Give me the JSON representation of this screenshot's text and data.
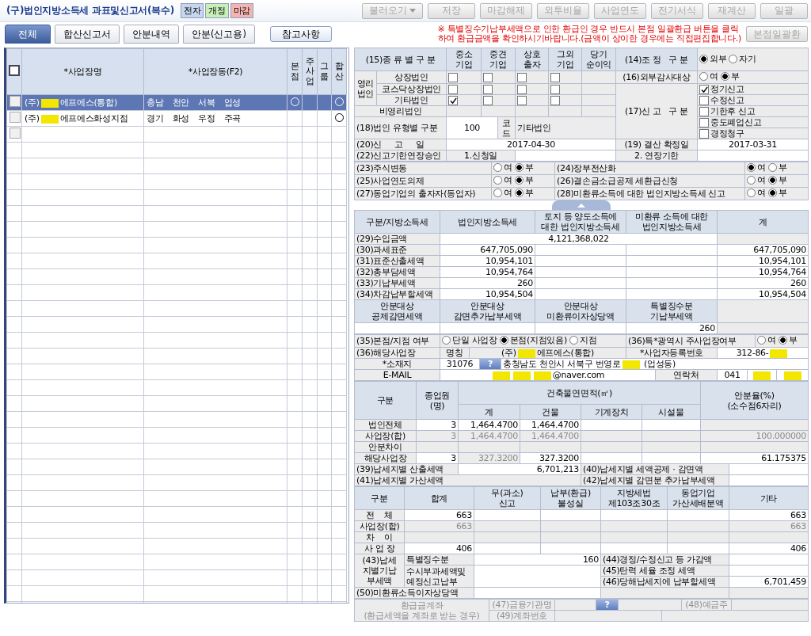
{
  "title": "(구)법인지방소득세 과표및신고서(복수)",
  "badges": [
    {
      "label": "전자",
      "color": "#c6d6ee"
    },
    {
      "label": "개정",
      "color": "#c8efb8"
    },
    {
      "label": "마감",
      "color": "#f5b4b4"
    }
  ],
  "toolbar": [
    {
      "label": "불러오기",
      "kind": "dropdown",
      "disabled": true
    },
    {
      "label": "저장",
      "kind": "button",
      "disabled": true
    },
    {
      "label": "마감해제",
      "kind": "button",
      "disabled": true
    },
    {
      "label": "외투비율",
      "kind": "button",
      "disabled": true
    },
    {
      "label": "사업연도",
      "kind": "button",
      "disabled": true
    },
    {
      "label": "전기서식",
      "kind": "button",
      "disabled": true
    },
    {
      "label": "재계산",
      "kind": "button",
      "disabled": true
    },
    {
      "label": "일괄",
      "kind": "button",
      "disabled": true
    }
  ],
  "tabs": [
    {
      "label": "전체",
      "selected": true
    },
    {
      "label": "합산신고서",
      "selected": false
    },
    {
      "label": "안분내역",
      "selected": false
    },
    {
      "label": "안분(신고용)",
      "selected": false
    }
  ],
  "reference_button": "참고사항",
  "notice": [
    "※ 특별징수기납부세액으로 인한 환급인 경우 반드시 본점 일괄환급 버튼을 클릭",
    "하여 환급금액을 확인하시기바랍니다.(금액이 상이한 경우에는 직접편집합니다.)"
  ],
  "hq_refund_button": {
    "label": "본점일괄환",
    "disabled": true
  },
  "sites": {
    "all_checked": false,
    "empty_row_checked": false,
    "columns": [
      "*사업장명",
      "*사업장동(F2)",
      "본점",
      "주사업",
      "그룹",
      "합산"
    ],
    "rows": [
      {
        "checked": false,
        "selected": true,
        "prefix": "(주)",
        "name": "에프에스(통합)",
        "dong": "충남 천안 서북 업성",
        "hq": true,
        "main": false,
        "group": false,
        "merged": true
      },
      {
        "checked": false,
        "selected": false,
        "prefix": "(주)",
        "name": "에프에스화성지점",
        "dong": "경기 화성 우정 주곡",
        "hq": false,
        "main": false,
        "group": false,
        "merged": true
      }
    ]
  },
  "kind_table": {
    "title": "(15)종 류 별 구 분",
    "columns": [
      "중소\n기업",
      "중견\n기업",
      "상호\n출자",
      "그외\n기업",
      "당기\n순이익"
    ],
    "group": "영리\n법인",
    "rows": [
      {
        "label": "상장법인",
        "checks": [
          false,
          false,
          false,
          false
        ]
      },
      {
        "label": "코스닥상장법인",
        "checks": [
          false,
          false,
          false,
          false
        ]
      },
      {
        "label": "기타법인",
        "checks": [
          true,
          false,
          false,
          false
        ]
      }
    ],
    "nonprofit": "비영리법인"
  },
  "adjustment": {
    "label": "(14)조 정   구 분",
    "options": [
      {
        "label": "외부",
        "selected": true
      },
      {
        "label": "자기",
        "selected": false
      }
    ]
  },
  "external_audit": {
    "label": "(16)외부감사대상",
    "options": [
      {
        "label": "여",
        "selected": false
      },
      {
        "label": "부",
        "selected": true
      }
    ]
  },
  "report_type": {
    "label": "(17)신 고   구 분",
    "options": [
      {
        "label": "정기신고",
        "checked": true
      },
      {
        "label": "수정신고",
        "checked": false
      },
      {
        "label": "기한후 신고",
        "checked": false
      },
      {
        "label": "중도폐업신고",
        "checked": false
      },
      {
        "label": "경정청구",
        "checked": false
      }
    ]
  },
  "corp_type": {
    "label": "(18)법인 유형별 구분",
    "code": "100",
    "code_label": "코\n드",
    "name": "기타법인"
  },
  "filing_date": {
    "label": "(20)신     고     일",
    "value": "2017-04-30"
  },
  "closing_date": {
    "label": "(19) 결산 확정일",
    "value": "2017-03-31"
  },
  "extension": {
    "label": "(22)신고기한연장승인",
    "apply_label": "1.신청일",
    "deadline_label": "2. 연장기한"
  },
  "yes_no": [
    {
      "label": "(23)주식변동",
      "options": [
        {
          "label": "여",
          "selected": false
        },
        {
          "label": "부",
          "selected": true
        }
      ]
    },
    {
      "label": "(24)장부전산화",
      "options": [
        {
          "label": "여",
          "selected": true
        },
        {
          "label": "부",
          "selected": false
        }
      ]
    },
    {
      "label": "(25)사업연도의제",
      "options": [
        {
          "label": "여",
          "selected": false
        },
        {
          "label": "부",
          "selected": true
        }
      ]
    },
    {
      "label": "(26)결손금소급공제 세환급신청",
      "options": [
        {
          "label": "여",
          "selected": false
        },
        {
          "label": "부",
          "selected": true
        }
      ]
    },
    {
      "label": "(27)동업기업의 출자자(동업자)",
      "options": [
        {
          "label": "여",
          "selected": false
        },
        {
          "label": "부",
          "selected": true
        }
      ]
    },
    {
      "label": "(28)미환류소득에 대한 법인지방소득세 신고",
      "options": [
        {
          "label": "여",
          "selected": false
        },
        {
          "label": "부",
          "selected": true
        }
      ]
    }
  ],
  "tax": {
    "columns": [
      "구분/지방소득세",
      "법인지방소득세",
      "토지 등 양도소득에\n대한 법인지방소득세",
      "미환류 소득에 대한\n법인지방소득세",
      "계"
    ],
    "revenue": {
      "label": "(29)수입금액",
      "value": "4,121,368,022"
    },
    "rows": [
      {
        "label": "(30)과세표준",
        "corp": "647,705,090",
        "total": "647,705,090"
      },
      {
        "label": "(31)표준산출세액",
        "corp": "10,954,101",
        "total": "10,954,101"
      },
      {
        "label": "(32)총부담세액",
        "corp": "10,954,764",
        "total": "10,954,764"
      },
      {
        "label": "(33)기납부세액",
        "corp": "260",
        "total": "260"
      },
      {
        "label": "(34)차감납부할세액",
        "corp": "10,954,504",
        "total": "10,954,504"
      }
    ],
    "alloc_columns": [
      "안분대상\n공제감면세액",
      "안분대상\n감면추가납부세액",
      "안분대상\n미환류이자상당액",
      "특별징수분\n기납부세액"
    ],
    "withheld": "260"
  },
  "branch": {
    "label": "(35)본점/지점 여부",
    "options": [
      {
        "label": "단일 사업장",
        "selected": false
      },
      {
        "label": "본점(지점있음)",
        "selected": true
      },
      {
        "label": "지점",
        "selected": false
      }
    ]
  },
  "metro": {
    "label": "(36)특*광역시 주사업장여부",
    "options": [
      {
        "label": "여",
        "selected": false
      },
      {
        "label": "부",
        "selected": true
      }
    ]
  },
  "site": {
    "label": "(36)해당사업장",
    "name_label": "명칭",
    "prefix": "(주)",
    "name": "에프에스(통합)",
    "regno_label": "*사업자등록번호",
    "regno": "312-86-"
  },
  "address": {
    "label": "*소재지",
    "zip": "31076",
    "search_button": "?",
    "street": "충청남도 천안시 서북구 번영로",
    "dong": "(업성동)"
  },
  "email": {
    "label": "E-MAIL",
    "domain": "@naver.com",
    "phone_label": "연락처",
    "area_code": "041"
  },
  "area": {
    "header_top": [
      "구분",
      "종업원\n(명)",
      "건축물연면적(㎡)",
      "안분율(%)\n(소수점6자리)"
    ],
    "header_sub": [
      "계",
      "건물",
      "기계장치",
      "시설물"
    ],
    "rows": [
      {
        "cells": [
          {
            "kind": "label",
            "text": "법인전체"
          },
          {
            "kind": "input",
            "text": "3"
          },
          {
            "kind": "input",
            "text": "1,464.4700"
          },
          {
            "kind": "input",
            "text": "1,464.4700"
          },
          {
            "kind": "input"
          },
          {
            "kind": "input"
          },
          {
            "kind": "blank"
          }
        ]
      },
      {
        "cells": [
          {
            "kind": "label",
            "text": "사업장(합)"
          },
          {
            "kind": "computed",
            "text": "3"
          },
          {
            "kind": "computed",
            "text": "1,464.4700"
          },
          {
            "kind": "computed",
            "text": "1,464.4700"
          },
          {
            "kind": "blank"
          },
          {
            "kind": "blank"
          },
          {
            "kind": "computed",
            "text": "100.000000"
          }
        ]
      },
      {
        "cells": [
          {
            "kind": "label",
            "text": "안분차이"
          },
          {
            "kind": "blank"
          },
          {
            "kind": "blank"
          },
          {
            "kind": "blank"
          },
          {
            "kind": "blank"
          },
          {
            "kind": "blank"
          },
          {
            "kind": "blank"
          }
        ]
      },
      {
        "cells": [
          {
            "kind": "label",
            "text": "해당사업장"
          },
          {
            "kind": "input",
            "text": "3"
          },
          {
            "kind": "computed",
            "text": "327.3200"
          },
          {
            "kind": "input",
            "text": "327.3200"
          },
          {
            "kind": "input"
          },
          {
            "kind": "input"
          },
          {
            "kind": "input",
            "text": "61.175375"
          }
        ]
      }
    ]
  },
  "calc": {
    "label": "(39)납세지별 산출세액",
    "value": "6,701,213"
  },
  "credit": {
    "label": "(40)납세지별 세액공제 · 감면액"
  },
  "penalty_tax": {
    "label": "(41)납세지별 가산세액"
  },
  "additional": {
    "label": "(42)납세지별 감면분 추가납부세액"
  },
  "penalty": {
    "columns": [
      "구분",
      "합계",
      "무(과소)\n신고",
      "납부(환급)\n불성실",
      "지방세법\n제103조30조",
      "동업기업\n가산세배분액",
      "기타"
    ],
    "rows": [
      {
        "cells": [
          {
            "kind": "label",
            "text": "전    체"
          },
          {
            "kind": "input",
            "text": "663"
          },
          {
            "kind": "input"
          },
          {
            "kind": "input"
          },
          {
            "kind": "input"
          },
          {
            "kind": "input"
          },
          {
            "kind": "input",
            "text": "663"
          }
        ]
      },
      {
        "cells": [
          {
            "kind": "label",
            "text": "사업장(합)"
          },
          {
            "kind": "computed",
            "text": "663"
          },
          {
            "kind": "blank"
          },
          {
            "kind": "blank"
          },
          {
            "kind": "blank"
          },
          {
            "kind": "blank"
          },
          {
            "kind": "computed",
            "text": "663"
          }
        ]
      },
      {
        "cells": [
          {
            "kind": "label",
            "text": "차    이"
          },
          {
            "kind": "blank"
          },
          {
            "kind": "blank"
          },
          {
            "kind": "blank"
          },
          {
            "kind": "blank"
          },
          {
            "kind": "blank"
          },
          {
            "kind": "blank"
          }
        ]
      },
      {
        "cells": [
          {
            "kind": "label",
            "text": "사 업 장"
          },
          {
            "kind": "input",
            "text": "406"
          },
          {
            "kind": "input"
          },
          {
            "kind": "input"
          },
          {
            "kind": "input"
          },
          {
            "kind": "input"
          },
          {
            "kind": "input",
            "text": "406"
          }
        ]
      }
    ]
  },
  "prepaid": {
    "label": "(43)납세\n지별기납\n부세액",
    "withheld_label": "특별징수분",
    "withheld": "160",
    "other_label": "수시부과세액및\n예정신고납부"
  },
  "adjust44": {
    "label": "(44)경정/수정신고 등 가감액"
  },
  "elastic": {
    "label": "(45)탄력 세율 조정 세액"
  },
  "payable": {
    "label": "(46)당해납세지에 납부할세액",
    "value": "6,701,459"
  },
  "interest": {
    "label": "(50)미환류소득이자상당액"
  },
  "refund": {
    "disabled": true,
    "label": "환급금계좌\n(환급세액을 계좌로 받는 경우)",
    "bank_label": "(47)금융기관명",
    "search_button": "?",
    "holder_label": "(48)예금주",
    "account_label": "(49)계좌번호"
  }
}
